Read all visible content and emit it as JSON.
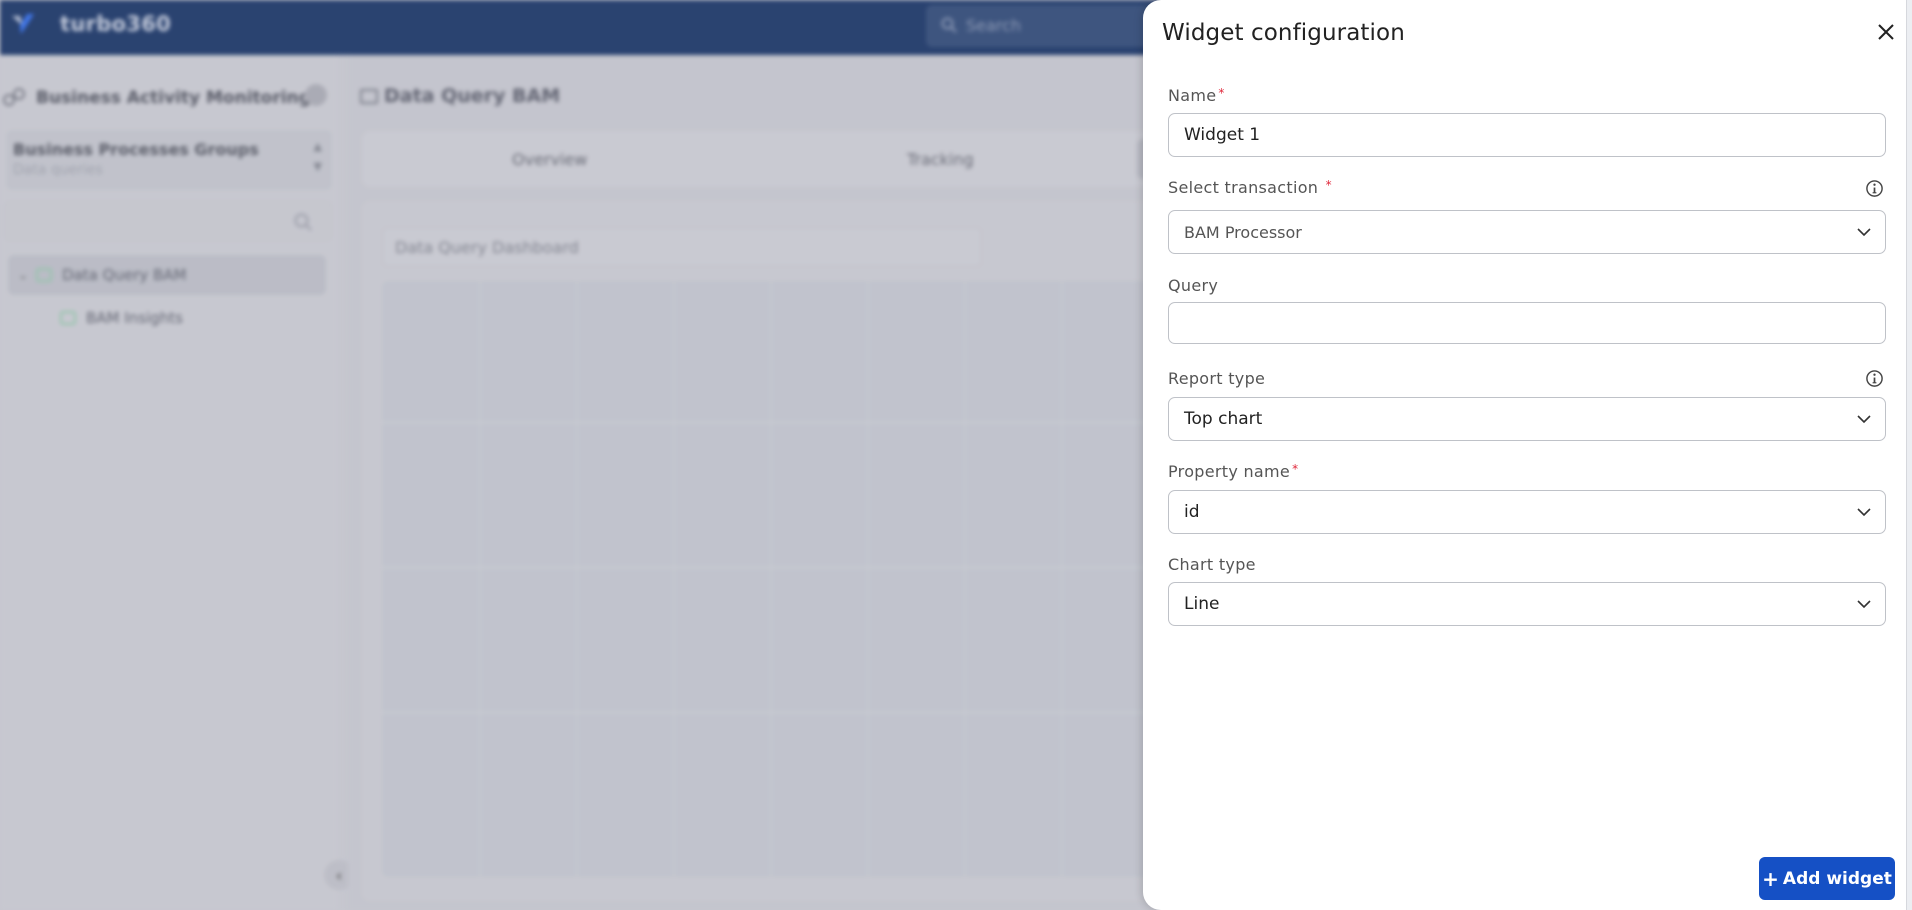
{
  "app": {
    "brand": "turbo360",
    "search_placeholder": "Search",
    "colors": {
      "topbar": "#122f62",
      "primary_button": "#1550c5",
      "required": "#e0283b"
    }
  },
  "sidebar": {
    "title": "Business Activity Monitoring",
    "group": {
      "title": "Business Processes Groups",
      "subtitle": "Data queries"
    },
    "tree": [
      {
        "label": "Data Query BAM",
        "selected": true,
        "expanded": true
      },
      {
        "label": "BAM Insights",
        "selected": false
      }
    ]
  },
  "main": {
    "breadcrumb": "Data Query BAM",
    "tabs": [
      {
        "label": "Overview"
      },
      {
        "label": "Tracking"
      },
      {
        "label": ""
      }
    ],
    "dashboard_title": "Data Query Dashboard"
  },
  "panel": {
    "title": "Widget configuration",
    "fields": {
      "name": {
        "label": "Name",
        "required": true,
        "value": "Widget 1"
      },
      "transaction": {
        "label": "Select transaction",
        "required": true,
        "value": "BAM Processor",
        "has_info": true
      },
      "query": {
        "label": "Query",
        "required": false,
        "value": ""
      },
      "report_type": {
        "label": "Report type",
        "required": false,
        "value": "Top chart",
        "has_info": true
      },
      "property_name": {
        "label": "Property name",
        "required": true,
        "value": "id"
      },
      "chart_type": {
        "label": "Chart type",
        "required": false,
        "value": "Line"
      }
    },
    "required_mark": "*",
    "add_button": {
      "icon": "+",
      "label": "Add widget"
    }
  }
}
